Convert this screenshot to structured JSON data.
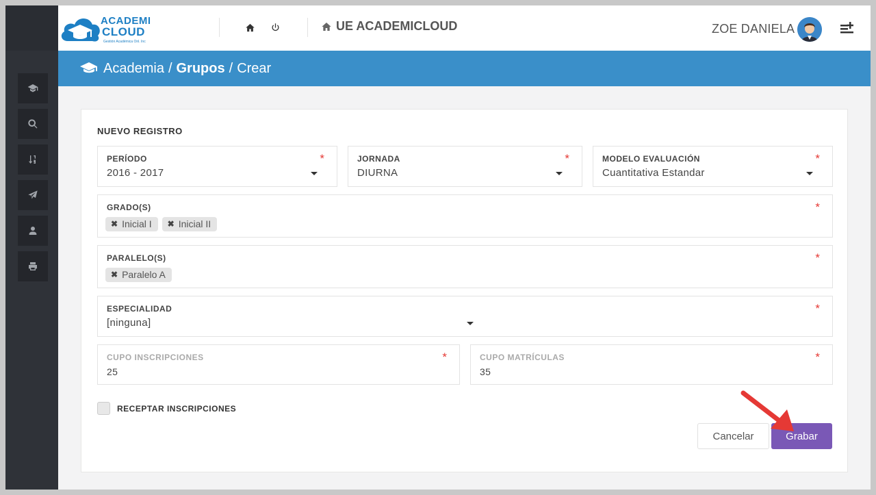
{
  "logo": {
    "line1": "ACADEMI",
    "line2": "CLOUD",
    "tagline": "Gestión Académica Onl. Inc"
  },
  "header": {
    "brand": "UE ACADEMICLOUD",
    "user_name": "ZOE DANIELA"
  },
  "breadcrumb": {
    "root": "Academia",
    "sep1": "/",
    "section": "Grupos",
    "sep2": "/",
    "page": "Crear"
  },
  "sidebar": {
    "items": [
      "graduation-cap-icon",
      "search-icon",
      "sort-numeric-icon",
      "paper-plane-icon",
      "user-icon",
      "print-icon"
    ]
  },
  "form": {
    "title": "NUEVO REGISTRO",
    "periodo": {
      "label": "PERÍODO",
      "value": "2016 - 2017",
      "required": "*"
    },
    "jornada": {
      "label": "JORNADA",
      "value": "DIURNA",
      "required": "*"
    },
    "modelo": {
      "label": "MODELO EVALUACIÓN",
      "value": "Cuantitativa Estandar",
      "required": "*"
    },
    "grados": {
      "label": "GRADO(S)",
      "required": "*",
      "tags": [
        "Inicial I",
        "Inicial II"
      ],
      "remove": "✖"
    },
    "paralelos": {
      "label": "PARALELO(S)",
      "required": "*",
      "tags": [
        "Paralelo A"
      ],
      "remove": "✖"
    },
    "especialidad": {
      "label": "ESPECIALIDAD",
      "value": "[ninguna]",
      "required": "*"
    },
    "cupo_inscripciones": {
      "label": "CUPO INSCRIPCIONES",
      "value": "25",
      "required": "*"
    },
    "cupo_matriculas": {
      "label": "CUPO MATRÍCULAS",
      "value": "35",
      "required": "*"
    },
    "receptar": {
      "label": "RECEPTAR INSCRIPCIONES",
      "checked": false
    },
    "cancel_label": "Cancelar",
    "save_label": "Grabar"
  },
  "colors": {
    "accent": "#3a8fc9",
    "primary_button": "#7a58b6",
    "sidebar": "#2f3238",
    "required": "#e53935",
    "annotation_arrow": "#e53935"
  }
}
